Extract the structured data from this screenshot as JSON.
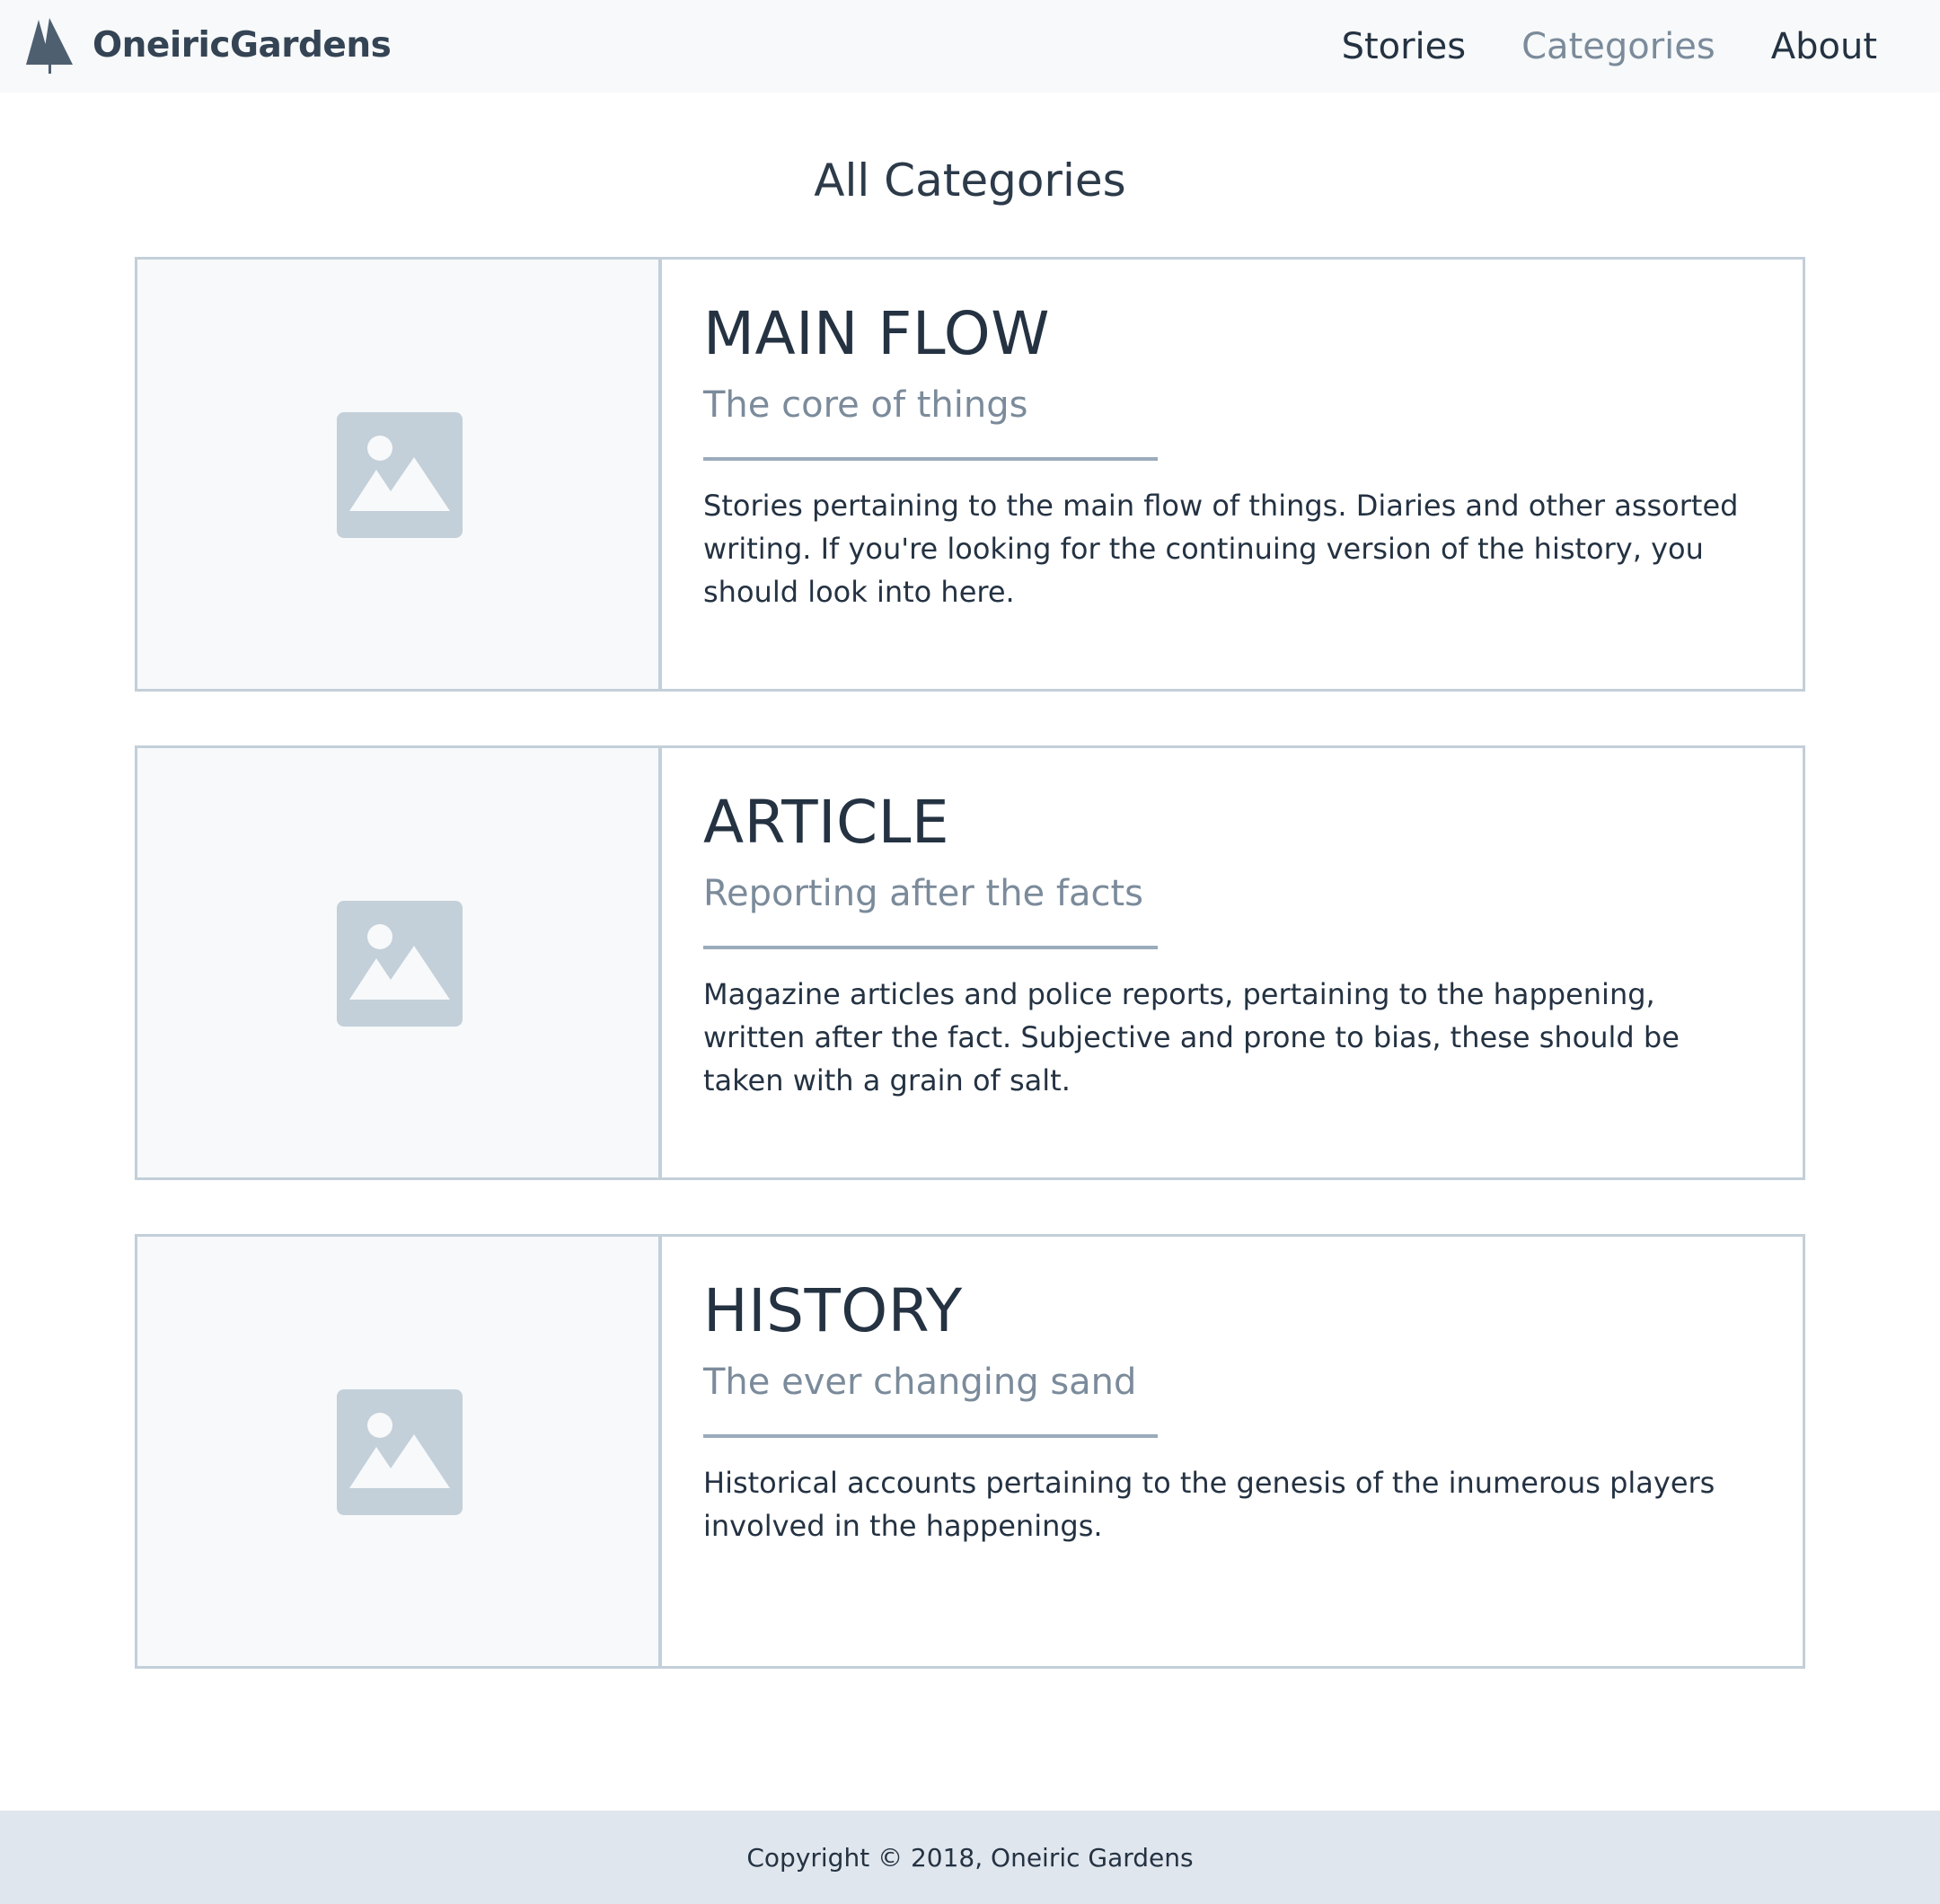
{
  "nav": {
    "brand": "OneiricGardens",
    "links": [
      {
        "label": "Stories",
        "active": false
      },
      {
        "label": "Categories",
        "active": true
      },
      {
        "label": "About",
        "active": false
      }
    ]
  },
  "page": {
    "title": "All Categories"
  },
  "categories": [
    {
      "title": "MAIN FLOW",
      "subtitle": "The core of things",
      "description": "Stories pertaining to the main flow of things. Diaries and other assorted writing. If you're looking for the continuing version of the history, you should look into here.",
      "image": "image-placeholder-icon"
    },
    {
      "title": "ARTICLE",
      "subtitle": "Reporting after the facts",
      "description": "Magazine articles and police reports, pertaining to the happening, written after the fact. Subjective and prone to bias, these should be taken with a grain of salt.",
      "image": "image-placeholder-icon"
    },
    {
      "title": "HISTORY",
      "subtitle": "The ever changing sand",
      "description": "Historical accounts pertaining to the genesis of the inumerous players involved in the happenings.",
      "image": "image-placeholder-icon"
    }
  ],
  "footer": {
    "copyright": "Copyright © 2018, Oneiric Gardens"
  },
  "colors": {
    "navbar_bg": "#f7f9fa",
    "text_dark": "#243242",
    "text_muted": "#7b8b9b",
    "border": "#c3cfd9",
    "placeholder": "#c3cfd9",
    "footer_bg": "#e0e6ed"
  }
}
